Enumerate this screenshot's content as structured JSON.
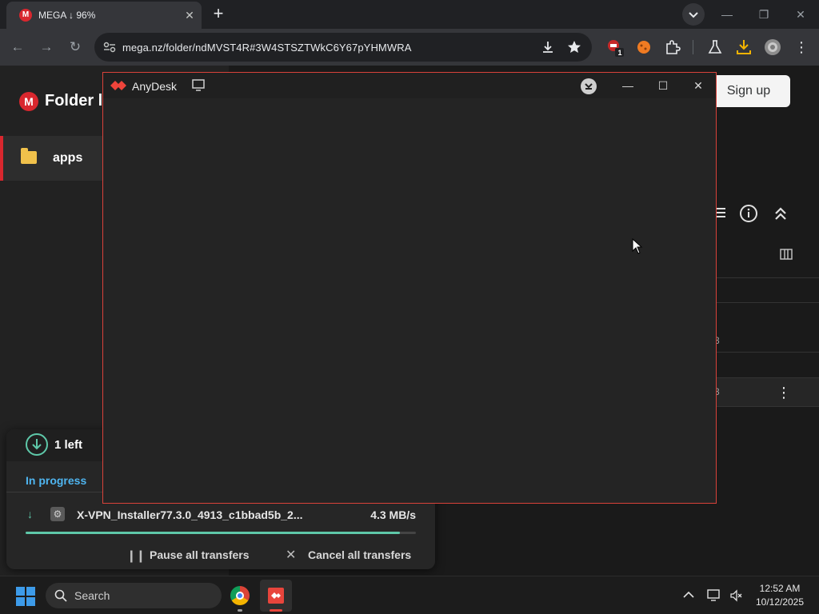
{
  "browser": {
    "tab_title": "MEGA ↓ 96%",
    "tab_favicon": "M",
    "url": "mega.nz/folder/ndMVST4R#3W4STSZTWkC6Y67pYHMWRA",
    "extension_badge": "1"
  },
  "mega": {
    "logo_letter": "M",
    "heading": "Folder l",
    "sidebar_item": "apps",
    "signup_label": "Sign up",
    "row_fragment_1": "3",
    "row_fragment_2": "3"
  },
  "transfers": {
    "left_count": "1 left",
    "section_label": "In progress",
    "file_name": "X-VPN_Installer77.3.0_4913_c1bbad5b_2...",
    "speed": "4.3 MB/s",
    "progress_percent": 96,
    "pause_label": "Pause all transfers",
    "cancel_label": "Cancel all transfers"
  },
  "anydesk": {
    "title": "AnyDesk",
    "accent_color": "#d9423a"
  },
  "taskbar": {
    "search_label": "Search",
    "time": "12:52 AM",
    "date": "10/12/2025"
  }
}
